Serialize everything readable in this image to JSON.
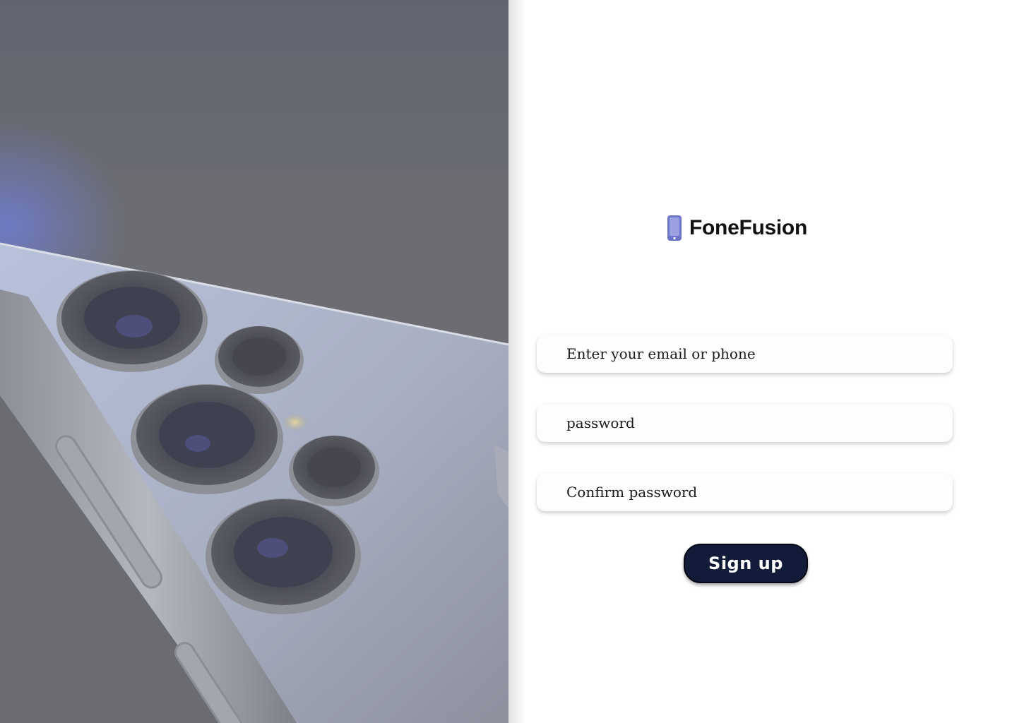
{
  "brand": {
    "name": "FoneFusion",
    "icon": "smartphone-icon",
    "accent_color": "#6b74c9"
  },
  "hero": {
    "image": "smartphone-camera-photo"
  },
  "form": {
    "email_placeholder": "Enter your email or phone",
    "password_placeholder": "password",
    "confirm_placeholder": "Confirm password",
    "submit_label": "Sign up",
    "submit_color": "#121c38"
  }
}
